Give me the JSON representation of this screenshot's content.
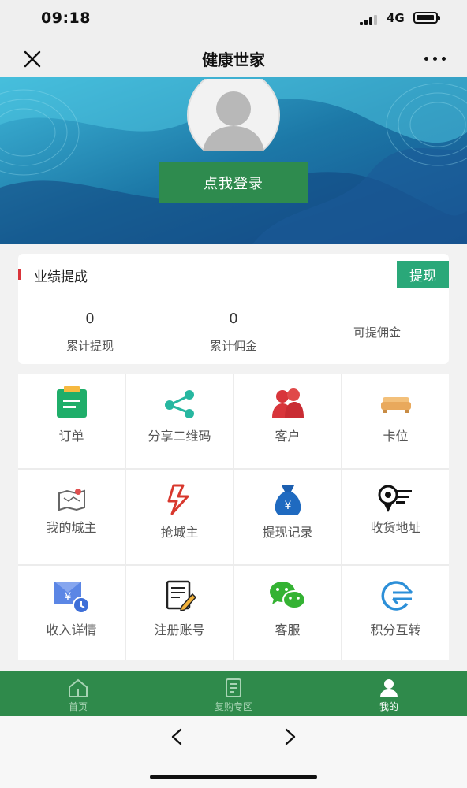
{
  "status_bar": {
    "time": "09:18",
    "network": "4G"
  },
  "nav": {
    "title": "健康世家"
  },
  "banner": {
    "login_label": "点我登录"
  },
  "performance": {
    "title": "业绩提成",
    "withdraw_label": "提现",
    "stats": [
      {
        "value": "0",
        "label": "累计提现"
      },
      {
        "value": "0",
        "label": "累计佣金"
      },
      {
        "value": "",
        "label": "可提佣金"
      }
    ]
  },
  "menu": [
    {
      "label": "订单",
      "icon": "order-icon"
    },
    {
      "label": "分享二维码",
      "icon": "share-icon"
    },
    {
      "label": "客户",
      "icon": "customers-icon"
    },
    {
      "label": "卡位",
      "icon": "sofa-icon"
    },
    {
      "label": "我的城主",
      "icon": "city-map-icon"
    },
    {
      "label": "抢城主",
      "icon": "lightning-icon"
    },
    {
      "label": "提现记录",
      "icon": "money-bag-icon"
    },
    {
      "label": "收货地址",
      "icon": "location-icon"
    },
    {
      "label": "收入详情",
      "icon": "income-icon"
    },
    {
      "label": "注册账号",
      "icon": "register-icon"
    },
    {
      "label": "客服",
      "icon": "wechat-icon"
    },
    {
      "label": "积分互转",
      "icon": "exchange-icon"
    }
  ],
  "tabbar": {
    "items": [
      {
        "label": "首页",
        "icon": "home-icon"
      },
      {
        "label": "复购专区",
        "icon": "repurchase-icon"
      },
      {
        "label": "我的",
        "icon": "profile-icon"
      }
    ],
    "active": "我的"
  },
  "colors": {
    "primary_green": "#2e8b4e",
    "teal": "#2aa879",
    "accent_red": "#d9343a"
  }
}
